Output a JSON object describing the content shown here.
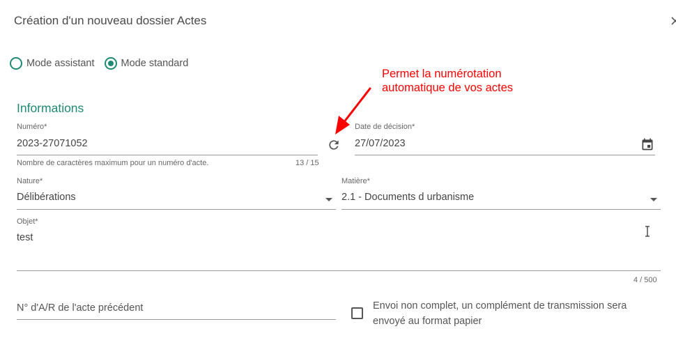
{
  "dialog": {
    "title": "Création d'un nouveau dossier Actes",
    "close_icon": "close-icon"
  },
  "mode": {
    "assistant_label": "Mode assistant",
    "standard_label": "Mode standard",
    "selected": "standard"
  },
  "section": {
    "title": "Informations"
  },
  "numero": {
    "label": "Numéro*",
    "value": "2023-27071052",
    "hint": "Nombre de caractères maximum pour un numéro d'acte.",
    "counter": "13 / 15",
    "refresh_icon": "refresh-icon"
  },
  "date_decision": {
    "label": "Date de décision*",
    "value": "27/07/2023",
    "icon": "calendar-icon"
  },
  "nature": {
    "label": "Nature*",
    "value": "Délibérations"
  },
  "matiere": {
    "label": "Matière*",
    "value": "2.1 - Documents d urbanisme"
  },
  "objet": {
    "label": "Objet*",
    "value": "test",
    "counter": "4 / 500"
  },
  "ar_precedent": {
    "placeholder": "N° d'A/R de l'acte précédent"
  },
  "envoi_non_complet": {
    "label": "Envoi non complet, un complément de transmission sera envoyé au format papier",
    "checked": false
  },
  "annotation": {
    "line1": "Permet la numérotation",
    "line2": "automatique de vos actes",
    "color": "#ff0000"
  },
  "colors": {
    "accent": "#1e8a74",
    "annotation": "#ff0000"
  }
}
